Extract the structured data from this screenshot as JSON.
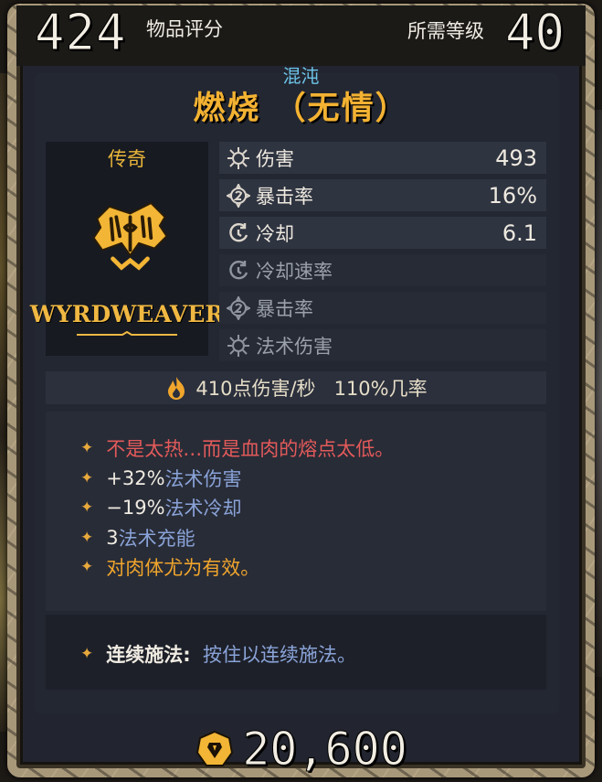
{
  "header": {
    "item_score": "424",
    "item_score_label": "物品评分",
    "required_level_label": "所需等级",
    "required_level": "40"
  },
  "item": {
    "element": "混沌",
    "name": "燃烧 （无情）",
    "rarity": "传奇",
    "brand": "WYRDWEAVER",
    "emblem_icon": "spellbook-icon"
  },
  "stats": [
    {
      "icon": "damage-icon",
      "name": "伤害",
      "value": "493",
      "active": true
    },
    {
      "icon": "crit-icon",
      "name": "暴击率",
      "value": "16%",
      "active": true
    },
    {
      "icon": "cooldown-icon",
      "name": "冷却",
      "value": "6.1",
      "active": true
    },
    {
      "icon": "cooldown-icon",
      "name": "冷却速率",
      "value": "",
      "active": false
    },
    {
      "icon": "crit-icon",
      "name": "暴击率",
      "value": "",
      "active": false
    },
    {
      "icon": "damage-icon",
      "name": "法术伤害",
      "value": "",
      "active": false
    }
  ],
  "dps": {
    "icon": "fire-icon",
    "dps_value": "410",
    "dps_label": "点伤害/秒",
    "proc_value": "110%",
    "proc_label": "几率"
  },
  "effects": [
    {
      "parts": [
        {
          "text": "不是太热…而是血肉的熔点太低。",
          "color": "red"
        }
      ]
    },
    {
      "parts": [
        {
          "text": "+32%",
          "color": "white"
        },
        {
          "text": "法术伤害",
          "color": "blue"
        }
      ]
    },
    {
      "parts": [
        {
          "text": "−19%",
          "color": "white"
        },
        {
          "text": "法术冷却",
          "color": "blue"
        }
      ]
    },
    {
      "parts": [
        {
          "text": "3",
          "color": "white"
        },
        {
          "text": "法术充能",
          "color": "blue"
        }
      ]
    },
    {
      "parts": [
        {
          "text": "对肉体尤为有效。",
          "color": "orange"
        }
      ]
    }
  ],
  "continuous": {
    "label": "连续施法:",
    "description": "按住以连续施法。"
  },
  "price": {
    "icon": "coin-icon",
    "value": "20,600"
  },
  "colors": {
    "gold": "#f3b232",
    "chaos_blue": "#6cc3e7",
    "flavor_red": "#e35a5a",
    "stat_blue": "#8aa3d8"
  }
}
